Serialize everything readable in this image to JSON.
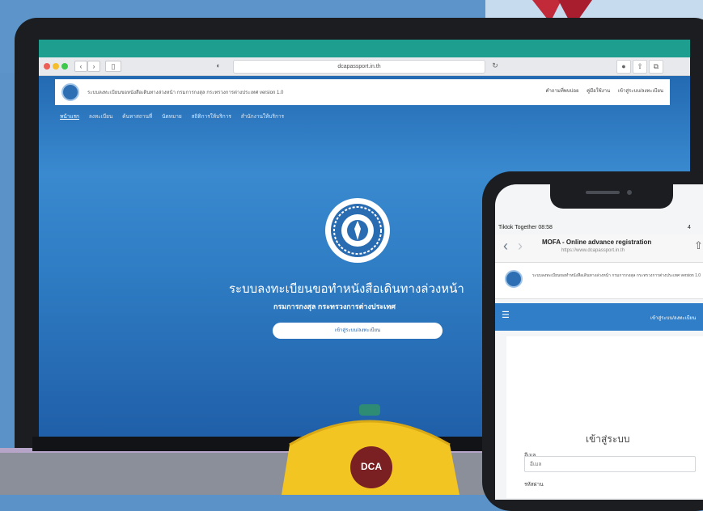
{
  "colors": {
    "background": "#5b93c9",
    "accent_teal": "#1d9e8e",
    "site_blue": "#2f7ec7",
    "hat_yellow": "#f2c522",
    "badge_maroon": "#7a1f22"
  },
  "browser": {
    "url": "dcapassport.in.th"
  },
  "site": {
    "title": "ระบบลงทะเบียนขอหนังสือเดินทางล่วงหน้า กรมการกงสุล กระทรวงการต่างประเทศ version 1.0",
    "links": [
      "คำถามที่พบบ่อย",
      "คู่มือใช้งาน",
      "เข้าสู่ระบบ/ลงทะเบียน"
    ],
    "menu": [
      "หน้าแรก",
      "ลงทะเบียน",
      "ค้นหาสถานที่",
      "นัดหมาย",
      "สถิติการให้บริการ",
      "สำนักงานให้บริการ"
    ],
    "hero_title": "ระบบลงทะเบียนขอทำหนังสือเดินทางล่วงหน้า",
    "hero_subtitle": "กรมการกงสุล กระทรวงการต่างประเทศ",
    "hero_button": "เข้าสู่ระบบ/ลงทะเบียน"
  },
  "phone": {
    "status_left": "Tiktok Together  08:58",
    "status_right": "4",
    "page_title": "MOFA - Online advance registration",
    "page_url": "https://www.dcapassport.in.th",
    "header_text": "ระบบลงทะเบียนขอทำหนังสือเดินทางล่วงหน้า กรมการกงสุล กระทรวงการต่างประเทศ version 1.0",
    "nav_login": "เข้าสู่ระบบ/ลงทะเบียน",
    "login_title": "เข้าสู่ระบบ",
    "email_label": "อีเมล",
    "email_value": "อีเมล",
    "password_label": "รหัสผ่าน"
  },
  "hat": {
    "badge_text": "DCA"
  }
}
